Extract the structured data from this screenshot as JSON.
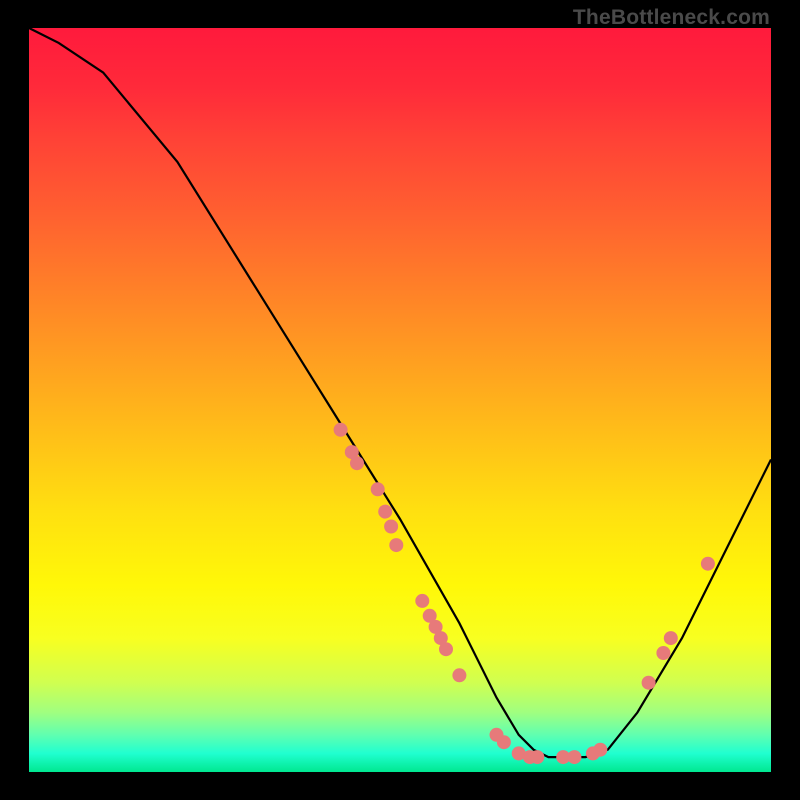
{
  "watermark": "TheBottleneck.com",
  "chart_data": {
    "type": "line",
    "title": "",
    "xlabel": "",
    "ylabel": "",
    "xlim": [
      0,
      100
    ],
    "ylim": [
      0,
      100
    ],
    "grid": false,
    "legend": false,
    "series": [
      {
        "name": "curve",
        "x": [
          0,
          4,
          10,
          20,
          30,
          40,
          50,
          58,
          63,
          66,
          68,
          70,
          72,
          75,
          78,
          82,
          88,
          94,
          100
        ],
        "y": [
          100,
          98,
          94,
          82,
          66,
          50,
          34,
          20,
          10,
          5,
          3,
          2,
          2,
          2,
          3,
          8,
          18,
          30,
          42
        ],
        "color": "#000000"
      }
    ],
    "markers": [
      {
        "x": 42.0,
        "y": 46.0
      },
      {
        "x": 43.5,
        "y": 43.0
      },
      {
        "x": 44.2,
        "y": 41.5
      },
      {
        "x": 47.0,
        "y": 38.0
      },
      {
        "x": 48.0,
        "y": 35.0
      },
      {
        "x": 48.8,
        "y": 33.0
      },
      {
        "x": 49.5,
        "y": 30.5
      },
      {
        "x": 53.0,
        "y": 23.0
      },
      {
        "x": 54.0,
        "y": 21.0
      },
      {
        "x": 54.8,
        "y": 19.5
      },
      {
        "x": 55.5,
        "y": 18.0
      },
      {
        "x": 56.2,
        "y": 16.5
      },
      {
        "x": 58.0,
        "y": 13.0
      },
      {
        "x": 63.0,
        "y": 5.0
      },
      {
        "x": 64.0,
        "y": 4.0
      },
      {
        "x": 66.0,
        "y": 2.5
      },
      {
        "x": 67.5,
        "y": 2.0
      },
      {
        "x": 68.5,
        "y": 2.0
      },
      {
        "x": 72.0,
        "y": 2.0
      },
      {
        "x": 73.5,
        "y": 2.0
      },
      {
        "x": 76.0,
        "y": 2.5
      },
      {
        "x": 77.0,
        "y": 3.0
      },
      {
        "x": 83.5,
        "y": 12.0
      },
      {
        "x": 85.5,
        "y": 16.0
      },
      {
        "x": 86.5,
        "y": 18.0
      },
      {
        "x": 91.5,
        "y": 28.0
      }
    ],
    "marker_color": "#e77a7a",
    "marker_radius": 7
  }
}
